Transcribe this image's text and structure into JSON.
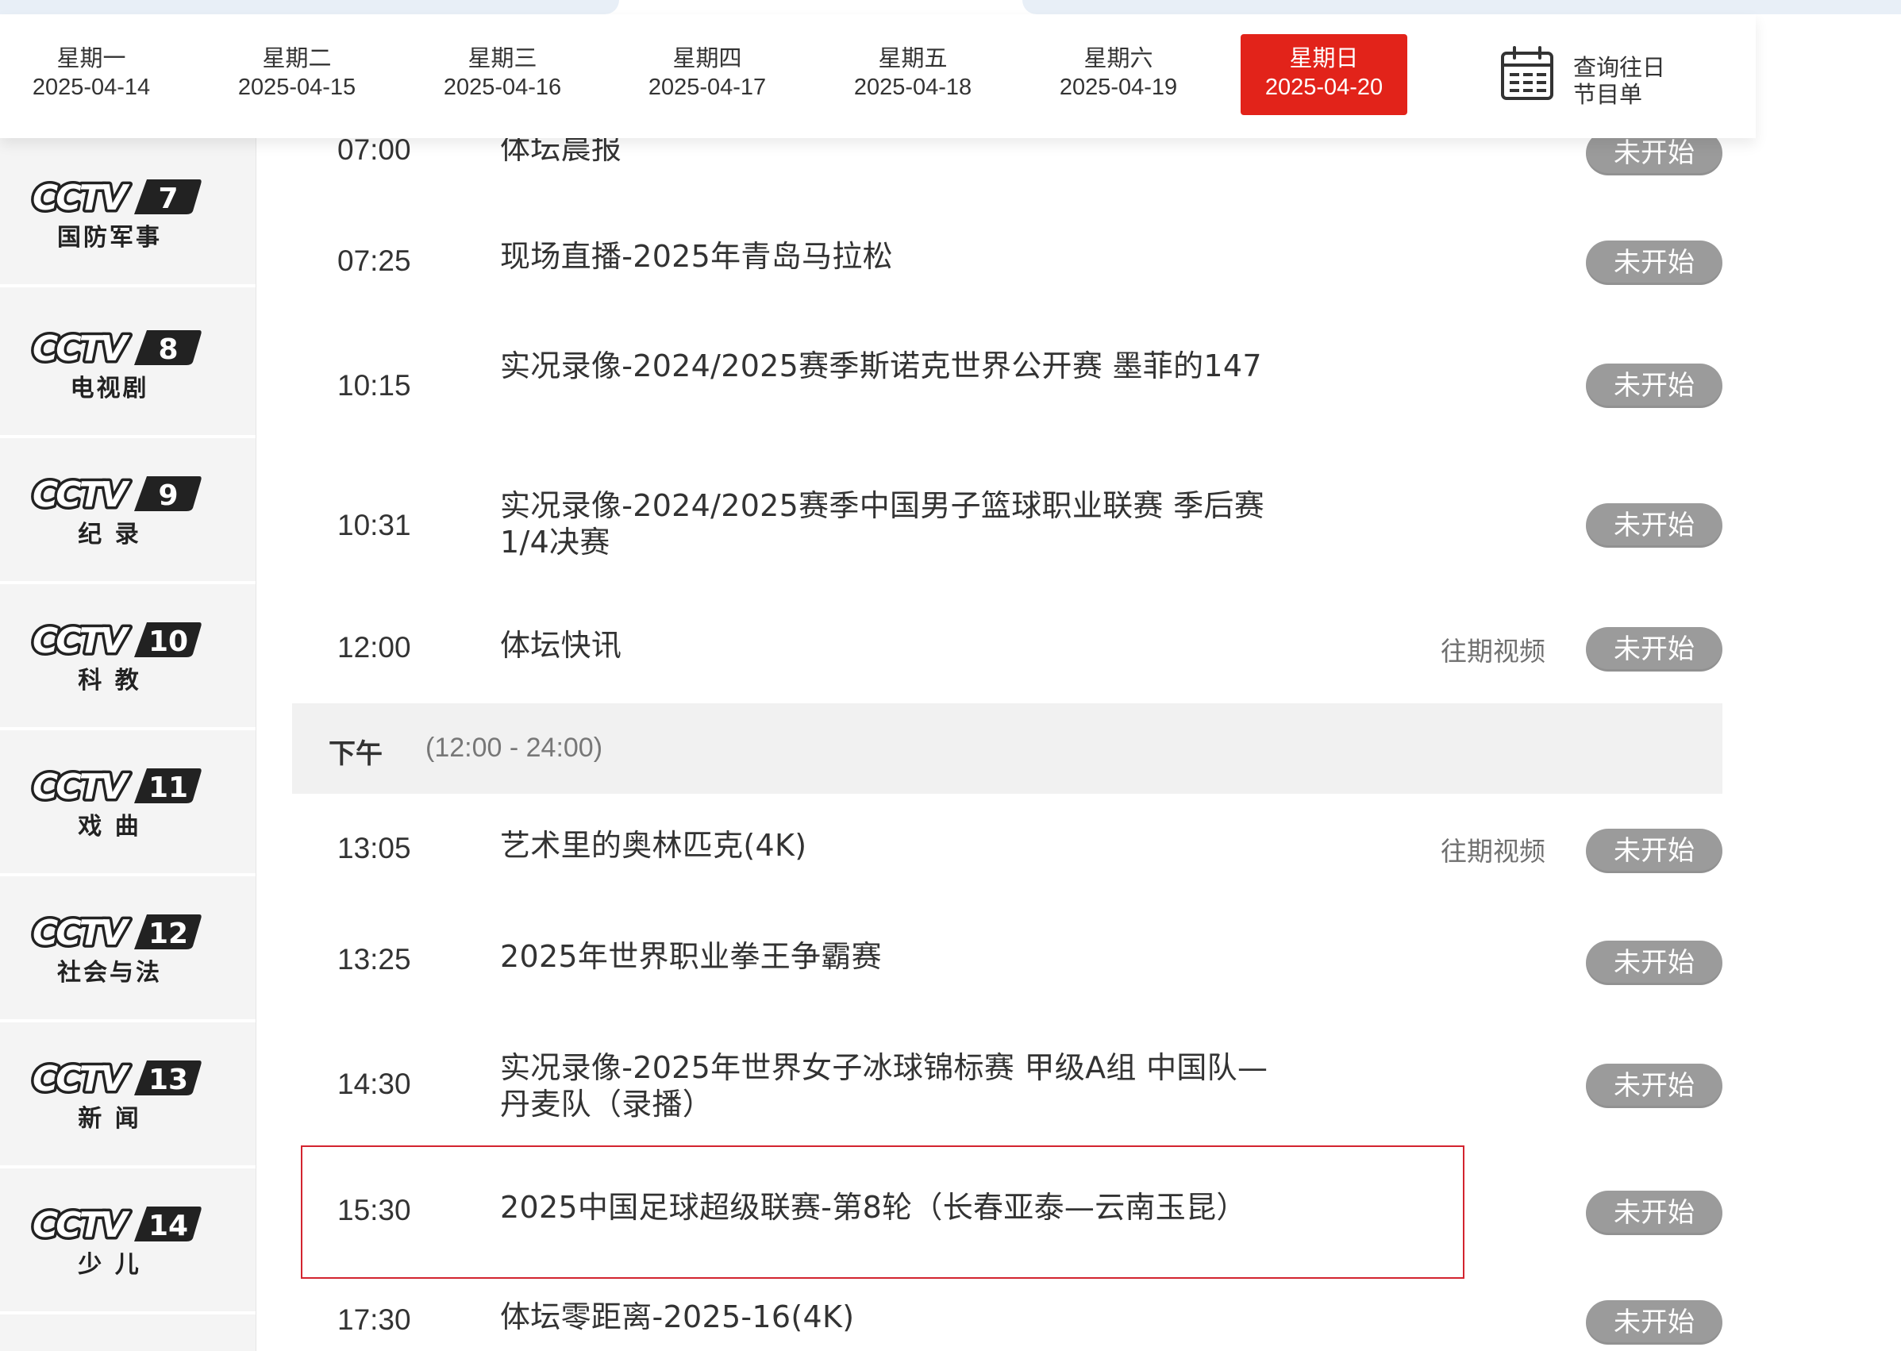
{
  "date_tabs": [
    {
      "weekday": "星期一",
      "date": "2025-04-14",
      "active": false
    },
    {
      "weekday": "星期二",
      "date": "2025-04-15",
      "active": false
    },
    {
      "weekday": "星期三",
      "date": "2025-04-16",
      "active": false
    },
    {
      "weekday": "星期四",
      "date": "2025-04-17",
      "active": false
    },
    {
      "weekday": "星期五",
      "date": "2025-04-18",
      "active": false
    },
    {
      "weekday": "星期六",
      "date": "2025-04-19",
      "active": false
    },
    {
      "weekday": "星期日",
      "date": "2025-04-20",
      "active": true
    }
  ],
  "history_query": {
    "line1": "查询往日",
    "line2": "节目单",
    "icon": "calendar-icon"
  },
  "channels": [
    {
      "number": "7",
      "name": "国防军事"
    },
    {
      "number": "8",
      "name": "电视剧"
    },
    {
      "number": "9",
      "name": "纪 录"
    },
    {
      "number": "10",
      "name": "科 教"
    },
    {
      "number": "11",
      "name": "戏 曲"
    },
    {
      "number": "12",
      "name": "社会与法"
    },
    {
      "number": "13",
      "name": "新 闻"
    },
    {
      "number": "14",
      "name": "少 儿"
    }
  ],
  "channel_logo_text": "CCTV",
  "section_afternoon": {
    "label": "下午",
    "range": "(12:00 - 24:00)"
  },
  "programs": [
    {
      "time": "07:00",
      "title": "体坛晨报",
      "replay": "",
      "status": "未开始"
    },
    {
      "time": "07:25",
      "title": "现场直播-2025年青岛马拉松",
      "replay": "",
      "status": "未开始"
    },
    {
      "time": "10:15",
      "title": "实况录像-2024/2025赛季斯诺克世界公开赛 墨菲的147",
      "replay": "",
      "status": "未开始"
    },
    {
      "time": "10:31",
      "title": "实况录像-2024/2025赛季中国男子篮球职业联赛 季后赛 1/4决赛",
      "replay": "",
      "status": "未开始"
    },
    {
      "time": "12:00",
      "title": "体坛快讯",
      "replay": "往期视频",
      "status": "未开始"
    },
    {
      "time": "13:05",
      "title": "艺术里的奥林匹克(4K)",
      "replay": "往期视频",
      "status": "未开始"
    },
    {
      "time": "13:25",
      "title": "2025年世界职业拳王争霸赛",
      "replay": "",
      "status": "未开始"
    },
    {
      "time": "14:30",
      "title": "实况录像-2025年世界女子冰球锦标赛 甲级A组 中国队—丹麦队（录播）",
      "replay": "",
      "status": "未开始"
    },
    {
      "time": "15:30",
      "title": "2025中国足球超级联赛-第8轮（长春亚泰—云南玉昆）",
      "replay": "",
      "status": "未开始"
    },
    {
      "time": "17:30",
      "title": "体坛零距离-2025-16(4K)",
      "replay": "",
      "status": "未开始"
    }
  ],
  "colors": {
    "accent": "#e2231a",
    "status_button": "#9b9b9b",
    "highlight_border": "#d3242f"
  }
}
